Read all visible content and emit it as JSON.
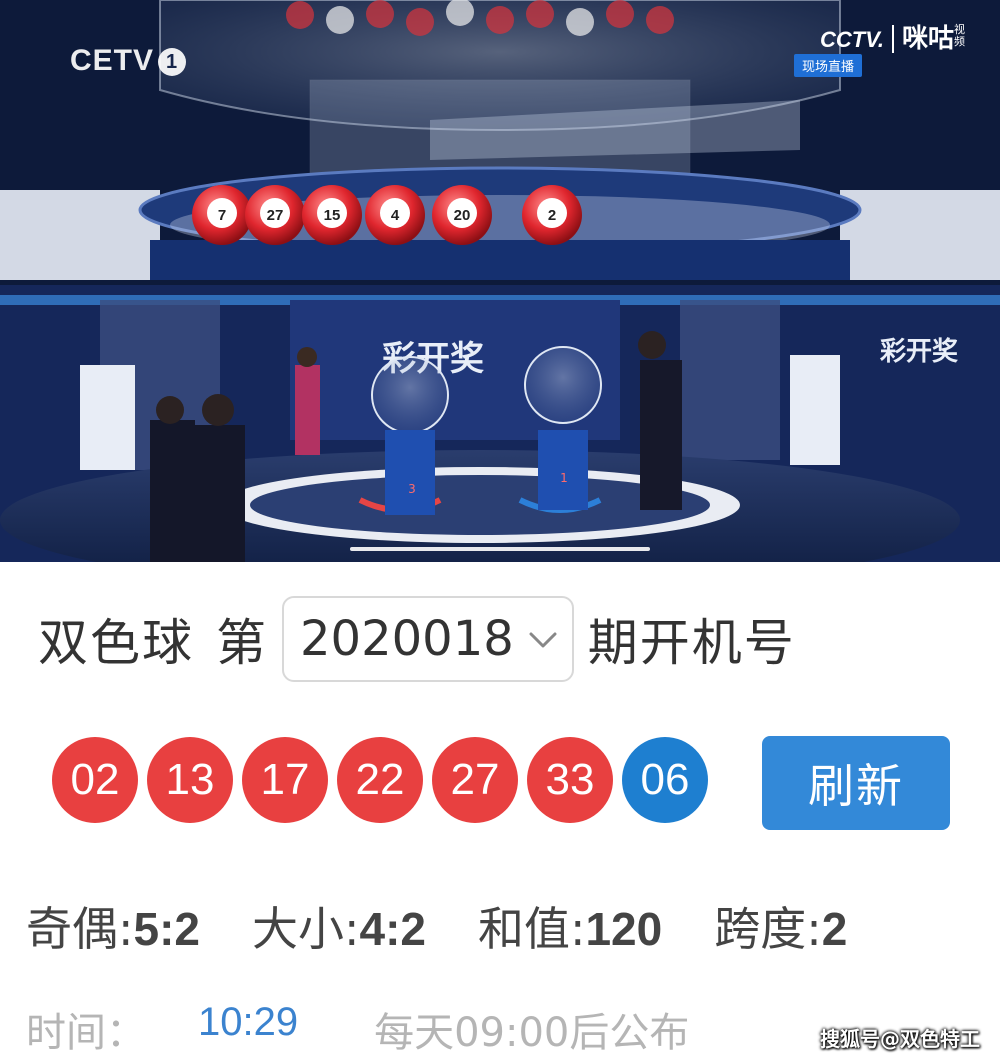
{
  "video": {
    "channel_logo": "CETV",
    "channel_number": "1",
    "partner_logo_cctv": "CCTV.",
    "partner_logo_migu": "咪咕",
    "partner_logo_migu_sub": "视频",
    "live_badge": "现场直播",
    "studio_sign": "彩开奖",
    "ball_machine_numbers": [
      "3",
      "1"
    ],
    "drawn_ball_numbers": [
      "7",
      "27",
      "15",
      "4",
      "20",
      "2"
    ]
  },
  "header": {
    "game_name": "双色球",
    "prefix": "第",
    "issue_number": "2020018",
    "suffix": "期开机号"
  },
  "balls": {
    "red": [
      "02",
      "13",
      "17",
      "22",
      "27",
      "33"
    ],
    "blue": [
      "06"
    ],
    "colors": {
      "red": "#e84040",
      "blue": "#1e7fd0"
    }
  },
  "refresh_button": {
    "label": "刷新",
    "color": "#3389d8"
  },
  "stats": [
    {
      "label": "奇偶:",
      "value": "5:2"
    },
    {
      "label": "大小:",
      "value": "4:2"
    },
    {
      "label": "和值:",
      "value": "120"
    },
    {
      "label": "跨度:",
      "value": "2"
    }
  ],
  "time_row": {
    "label": "时间：",
    "time": "10:29",
    "note": "每天09:00后公布"
  },
  "watermark": "搜狐号@双色特工"
}
